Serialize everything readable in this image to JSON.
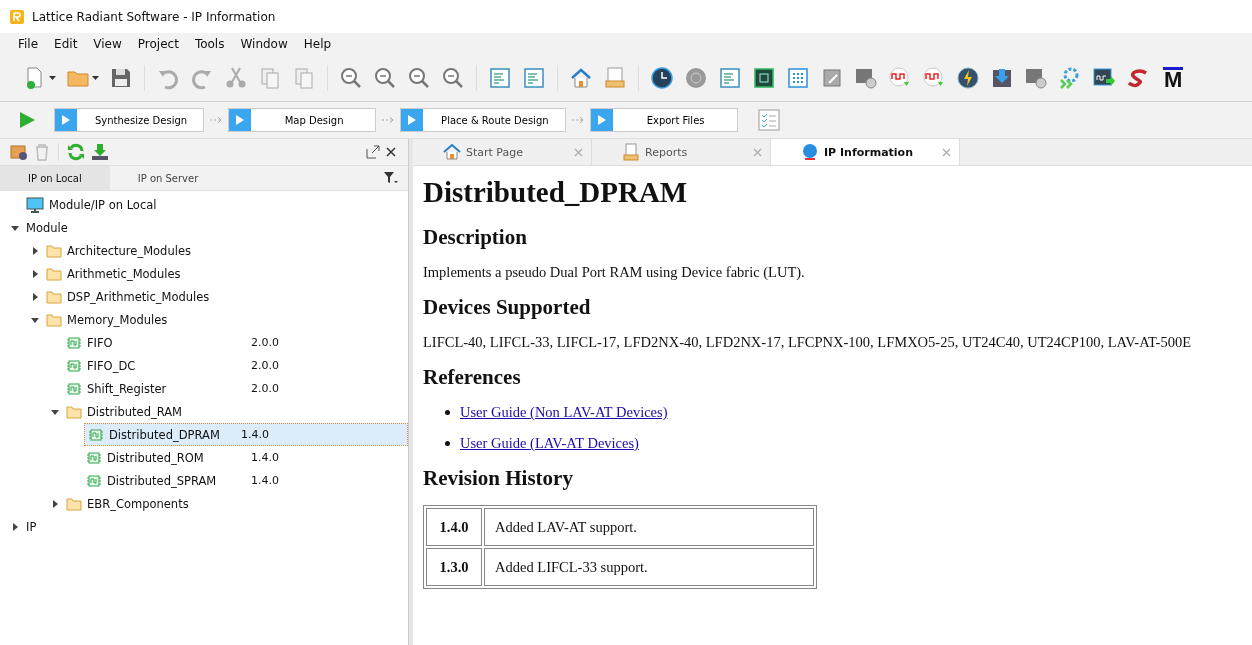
{
  "window": {
    "title": "Lattice Radiant Software - IP Information"
  },
  "menu": [
    "File",
    "Edit",
    "View",
    "Project",
    "Tools",
    "Window",
    "Help"
  ],
  "toolbar": {
    "logo_text": "M"
  },
  "flow": [
    {
      "label": "Synthesize Design"
    },
    {
      "label": "Map Design"
    },
    {
      "label": "Place & Route Design"
    },
    {
      "label": "Export Files"
    }
  ],
  "left_panel": {
    "tabs": [
      {
        "label": "IP on Local",
        "selected": true
      },
      {
        "label": "IP on Server",
        "selected": false
      }
    ],
    "tree": [
      {
        "label": "Module/IP on Local",
        "kind": "computer"
      },
      {
        "label": "Module",
        "kind": "root",
        "expanded": true,
        "children": [
          {
            "label": "Architecture_Modules",
            "kind": "folder",
            "expanded": false
          },
          {
            "label": "Arithmetic_Modules",
            "kind": "folder",
            "expanded": false
          },
          {
            "label": "DSP_Arithmetic_Modules",
            "kind": "folder",
            "expanded": false
          },
          {
            "label": "Memory_Modules",
            "kind": "folder",
            "expanded": true,
            "children": [
              {
                "label": "FIFO",
                "kind": "module",
                "version": "2.0.0",
                "selected": false
              },
              {
                "label": "FIFO_DC",
                "kind": "module",
                "version": "2.0.0",
                "selected": false
              },
              {
                "label": "Shift_Register",
                "kind": "module",
                "version": "2.0.0",
                "selected": false
              },
              {
                "label": "Distributed_RAM",
                "kind": "folder",
                "expanded": true,
                "children": [
                  {
                    "label": "Distributed_DPRAM",
                    "kind": "module",
                    "version": "1.4.0",
                    "selected": true
                  },
                  {
                    "label": "Distributed_ROM",
                    "kind": "module",
                    "version": "1.4.0",
                    "selected": false
                  },
                  {
                    "label": "Distributed_SPRAM",
                    "kind": "module",
                    "version": "1.4.0",
                    "selected": false
                  }
                ]
              },
              {
                "label": "EBR_Components",
                "kind": "folder",
                "expanded": false
              }
            ]
          }
        ]
      },
      {
        "label": "IP",
        "kind": "root",
        "expanded": false
      }
    ]
  },
  "doc_tabs": [
    {
      "label": "Start Page",
      "selected": false
    },
    {
      "label": "Reports",
      "selected": false
    },
    {
      "label": "IP Information",
      "selected": true
    }
  ],
  "page": {
    "title": "Distributed_DPRAM",
    "sections": [
      {
        "heading": "Description",
        "kind": "text",
        "text": "Implements a pseudo Dual Port RAM using Device fabric (LUT)."
      },
      {
        "heading": "Devices Supported",
        "kind": "text",
        "text": "LIFCL-40, LIFCL-33, LIFCL-17, LFD2NX-40, LFD2NX-17, LFCPNX-100, LFMXO5-25, UT24C40, UT24CP100, LAV-AT-500E"
      },
      {
        "heading": "References",
        "kind": "links",
        "links": [
          "User Guide (Non LAV-AT Devices)",
          "User Guide (LAV-AT Devices)"
        ]
      },
      {
        "heading": "Revision History",
        "kind": "table",
        "rows": [
          [
            "1.4.0",
            "Added LAV-AT support."
          ],
          [
            "1.3.0",
            "Added LIFCL-33 support."
          ]
        ]
      }
    ]
  }
}
